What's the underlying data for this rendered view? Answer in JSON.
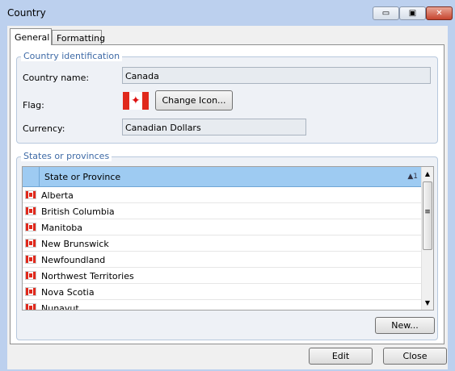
{
  "window": {
    "title": "Country",
    "min_symbol": "▭",
    "max_symbol": "▣",
    "close_symbol": "✕"
  },
  "tabs": [
    {
      "label": "General"
    },
    {
      "label": "Formatting"
    }
  ],
  "country_group": {
    "legend": "Country identification",
    "name_label": "Country name:",
    "name_value": "Canada",
    "flag_label": "Flag:",
    "change_icon_label": "Change Icon...",
    "currency_label": "Currency:",
    "currency_value": "Canadian Dollars"
  },
  "states_group": {
    "legend": "States or provinces",
    "column_header": "State or Province",
    "sort_indicator": "▲1",
    "rows": [
      "Alberta",
      "British Columbia",
      "Manitoba",
      "New Brunswick",
      "Newfoundland",
      "Northwest Territories",
      "Nova Scotia",
      "Nunavut"
    ],
    "new_button_label": "New..."
  },
  "footer": {
    "edit_label": "Edit",
    "close_label": "Close"
  },
  "colors": {
    "window_bg": "#bcd0ee",
    "header_bg": "#9ecbf2",
    "legend_text": "#3e6aa6",
    "flag_red": "#e0291c"
  }
}
